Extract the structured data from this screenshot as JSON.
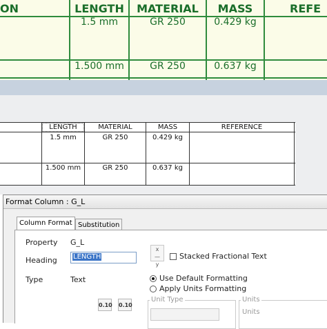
{
  "top_table": {
    "headers": [
      "ON",
      "LENGTH",
      "MATERIAL",
      "MASS",
      "REFE"
    ],
    "rows": [
      [
        "1.5 mm",
        "GR 250",
        "0.429 kg"
      ],
      [
        "1.500 mm",
        "GR 250",
        "0.637 kg"
      ]
    ],
    "colors": {
      "line": "#2e8b3c",
      "text": "#1a6e2a",
      "background": "#fbfce8"
    }
  },
  "preview_table": {
    "headers": [
      "LENGTH",
      "MATERIAL",
      "MASS",
      "REFERENCE"
    ],
    "rows": [
      [
        "1.5 mm",
        "GR 250",
        "0.429 kg",
        ""
      ],
      [
        "1.500 mm",
        "GR 250",
        "0.637 kg",
        ""
      ]
    ]
  },
  "dialog": {
    "title": "Format Column : G_L",
    "tabs": [
      {
        "label": "Column Format",
        "active": true
      },
      {
        "label": "Substitution",
        "active": false
      }
    ],
    "property_label": "Property",
    "property_value": "G_L",
    "heading_label": "Heading",
    "heading_value": "LENGTH",
    "type_label": "Type",
    "type_value": "Text",
    "stacked_fractional_label": "Stacked Fractional Text",
    "stacked_fractional_checked": false,
    "use_default_label": "Use Default Formatting",
    "use_default_selected": true,
    "apply_units_label": "Apply Units Formatting",
    "apply_units_selected": false,
    "precision_buttons": [
      "0.10",
      "0.10"
    ],
    "unit_type_label": "Unit Type",
    "units_group_label": "Units",
    "units_label": "Units",
    "frac_icon": "fraction-icon"
  }
}
